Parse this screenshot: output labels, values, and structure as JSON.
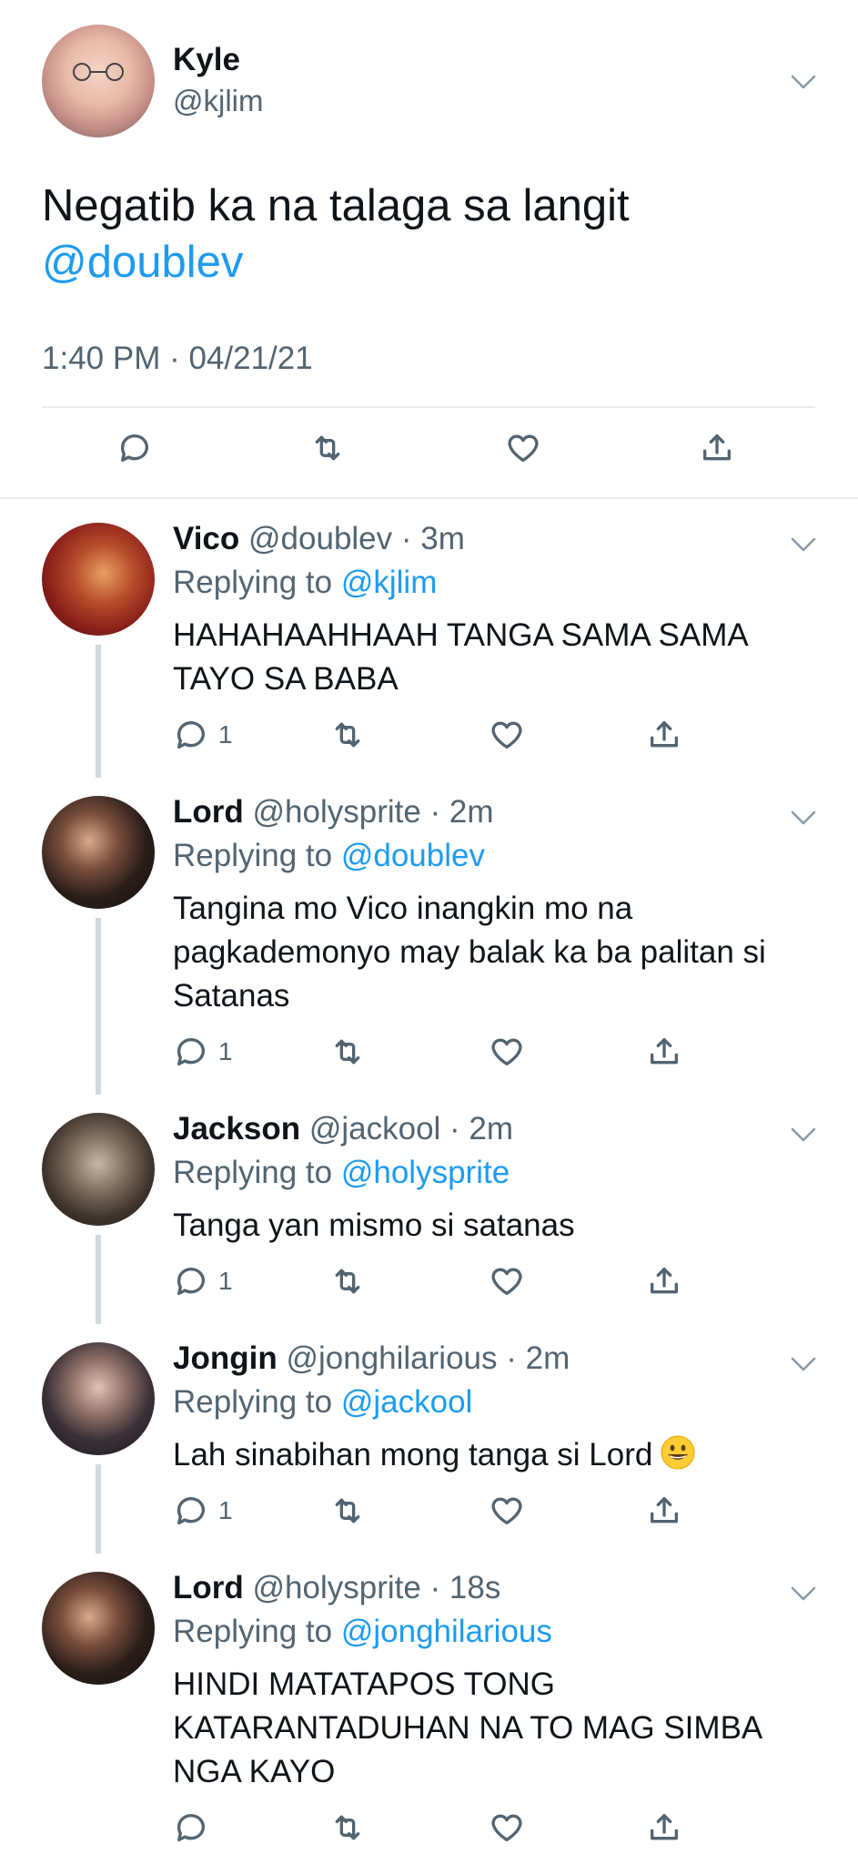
{
  "main_tweet": {
    "name": "Kyle",
    "handle": "@kjlim",
    "text": "Negatib ka na talaga sa langit",
    "mention": "@doublev",
    "timestamp": "1:40 PM · 04/21/21",
    "actions": [
      "reply-icon",
      "retweet-icon",
      "like-icon",
      "share-icon"
    ]
  },
  "replies": [
    {
      "name": "Vico",
      "meta": "@doublev · 3m",
      "replying_label": "Replying to",
      "replying_to": "@kjlim",
      "text": "HAHAHAAHHAAH TANGA SAMA SAMA TAYO SA BABA",
      "reply_count": "1"
    },
    {
      "name": "Lord",
      "meta": "@holysprite · 2m",
      "replying_label": "Replying to",
      "replying_to": "@doublev",
      "text": "Tangina mo Vico inangkin mo na pagkademonyo may balak ka ba palitan si Satanas",
      "reply_count": "1"
    },
    {
      "name": "Jackson",
      "meta": "@jackool · 2m",
      "replying_label": "Replying to",
      "replying_to": "@holysprite",
      "text": "Tanga yan mismo si satanas",
      "reply_count": "1"
    },
    {
      "name": "Jongin",
      "meta": "@jonghilarious · 2m",
      "replying_label": "Replying to",
      "replying_to": "@jackool",
      "text": "Lah sinabihan mong tanga si Lord",
      "emoji": "grinning-face-emoji",
      "reply_count": "1"
    },
    {
      "name": "Lord",
      "meta": "@holysprite · 18s",
      "replying_label": "Replying to",
      "replying_to": "@jonghilarious",
      "text": "HINDI MATATAPOS TONG KATARANTADUHAN NA TO MAG SIMBA NGA KAYO",
      "reply_count": ""
    }
  ],
  "colors": {
    "accent": "#1d9bf0",
    "text": "#0f1419",
    "muted": "#536471",
    "divider": "#e6ecf0",
    "thread_line": "#cfd9de"
  }
}
